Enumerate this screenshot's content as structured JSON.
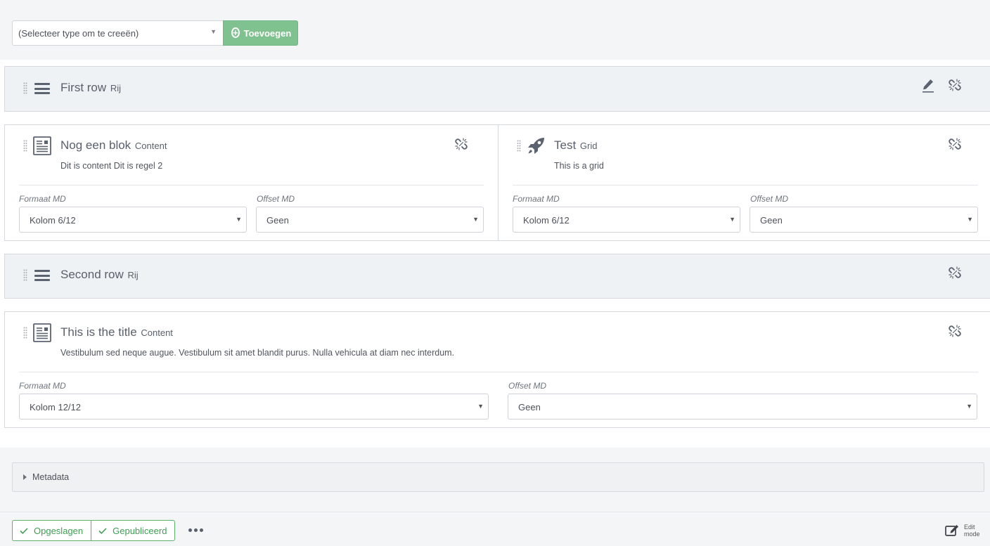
{
  "toolbar": {
    "type_select_value": "(Selecteer type om te creeën)",
    "add_label": "Toevoegen"
  },
  "rows": [
    {
      "title": "First row",
      "type": "Rij",
      "blocks": [
        {
          "title": "Nog een blok",
          "type": "Content",
          "description": "Dit is content Dit is regel 2",
          "format_label": "Formaat MD",
          "format_value": "Kolom 6/12",
          "offset_label": "Offset MD",
          "offset_value": "Geen"
        },
        {
          "title": "Test",
          "type": "Grid",
          "description": "This is a grid",
          "format_label": "Formaat MD",
          "format_value": "Kolom 6/12",
          "offset_label": "Offset MD",
          "offset_value": "Geen"
        }
      ]
    },
    {
      "title": "Second row",
      "type": "Rij",
      "blocks": [
        {
          "title": "This is the title",
          "type": "Content",
          "description": "Vestibulum sed neque augue. Vestibulum sit amet blandit purus. Nulla vehicula at diam nec interdum.",
          "format_label": "Formaat MD",
          "format_value": "Kolom 12/12",
          "offset_label": "Offset MD",
          "offset_value": "Geen"
        }
      ]
    }
  ],
  "metadata_label": "Metadata",
  "footer": {
    "saved_label": "Opgeslagen",
    "published_label": "Gepubliceerd",
    "edit_mode_line1": "Edit",
    "edit_mode_line2": "mode"
  },
  "colors": {
    "accent_green": "#7fc18f",
    "status_green": "#3f9e52",
    "row_background": "#eff2f5"
  }
}
